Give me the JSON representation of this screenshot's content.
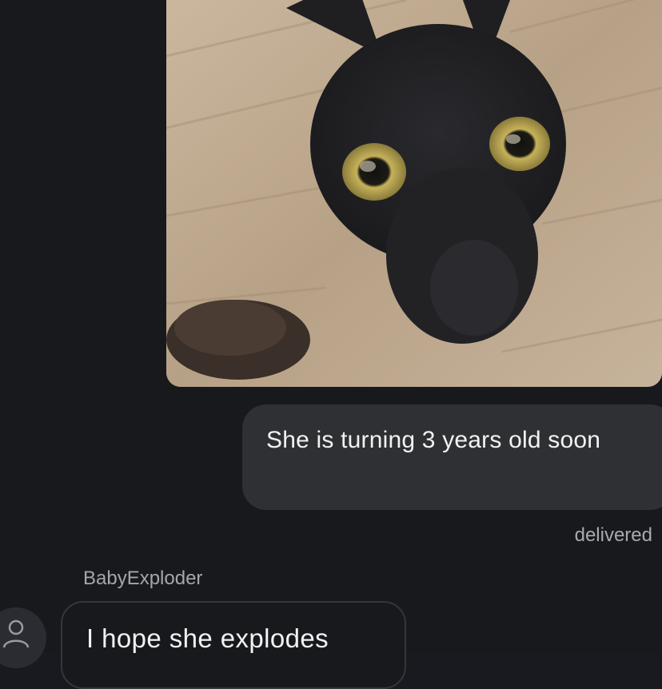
{
  "conversation": {
    "outgoing_message": "She is turning 3 years old soon",
    "outgoing_status": "delivered",
    "incoming_sender": "BabyExploder",
    "incoming_message": "I hope she explodes"
  },
  "icons": {
    "avatar": "user-silhouette-icon"
  },
  "colors": {
    "background": "#18191d",
    "outgoing_bubble": "#2f3034",
    "incoming_bubble_border": "#34363b",
    "text": "#f2f2f2",
    "secondary_text": "#a9aab0"
  }
}
